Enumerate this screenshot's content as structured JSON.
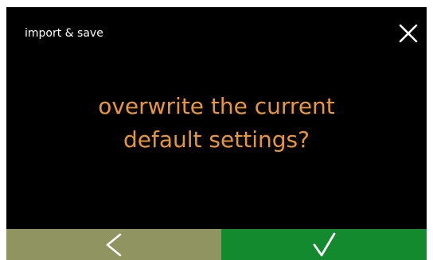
{
  "header": {
    "title": "import & save"
  },
  "dialog": {
    "question_line1": "overwrite the current",
    "question_line2": "default settings?"
  },
  "icons": {
    "close": "close-icon",
    "back": "chevron-left-icon",
    "confirm": "checkmark-icon"
  },
  "colors": {
    "background": "#000000",
    "title_text": "#ffffff",
    "question_text": "#e8963a",
    "back_button": "#8f9460",
    "confirm_button": "#138a2e",
    "icon": "#ffffff"
  }
}
